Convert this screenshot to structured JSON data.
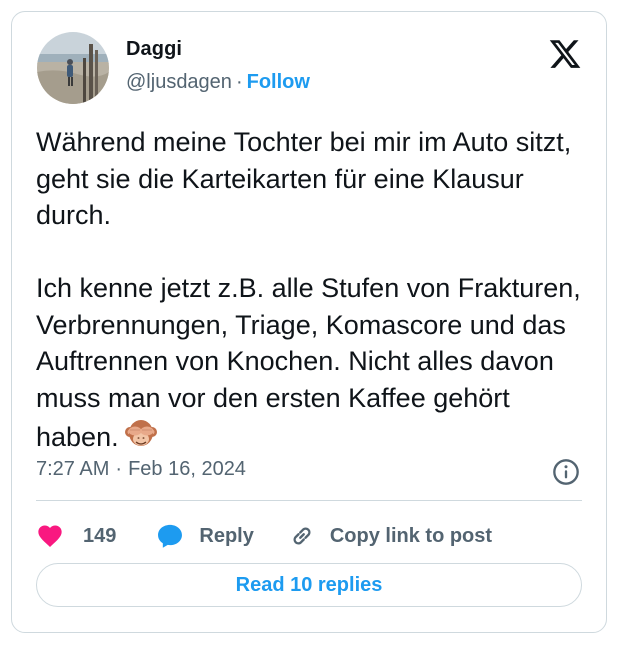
{
  "author": {
    "display_name": "Daggi",
    "handle": "@ljusdagen",
    "separator": "·",
    "follow_label": "Follow",
    "avatar_icon": "avatar-beach-photo"
  },
  "logo_icon": "x-logo-icon",
  "tweet": {
    "text": "Während meine Tochter bei mir im Auto sitzt, geht sie die Karteikarten für eine Klausur durch.\n\nIch kenne jetzt z.B. alle Stufen von Frakturen, Verbrennungen, Triage, Komascore und das Auftrennen von Knochen. Nicht alles davon muss man vor den ersten Kaffee gehört haben.",
    "emoji_icon": "see-no-evil-monkey-icon"
  },
  "meta": {
    "time": "7:27 AM",
    "separator": "·",
    "date": "Feb 16, 2024",
    "info_icon": "info-icon"
  },
  "actions": {
    "like_count": "149",
    "reply_label": "Reply",
    "copy_label": "Copy link to post"
  },
  "read_replies_label": "Read 10 replies",
  "colors": {
    "accent": "#1d9bf0",
    "like": "#f91880",
    "text": "#0f1419",
    "secondary": "#536471",
    "border": "#cfd9de"
  }
}
